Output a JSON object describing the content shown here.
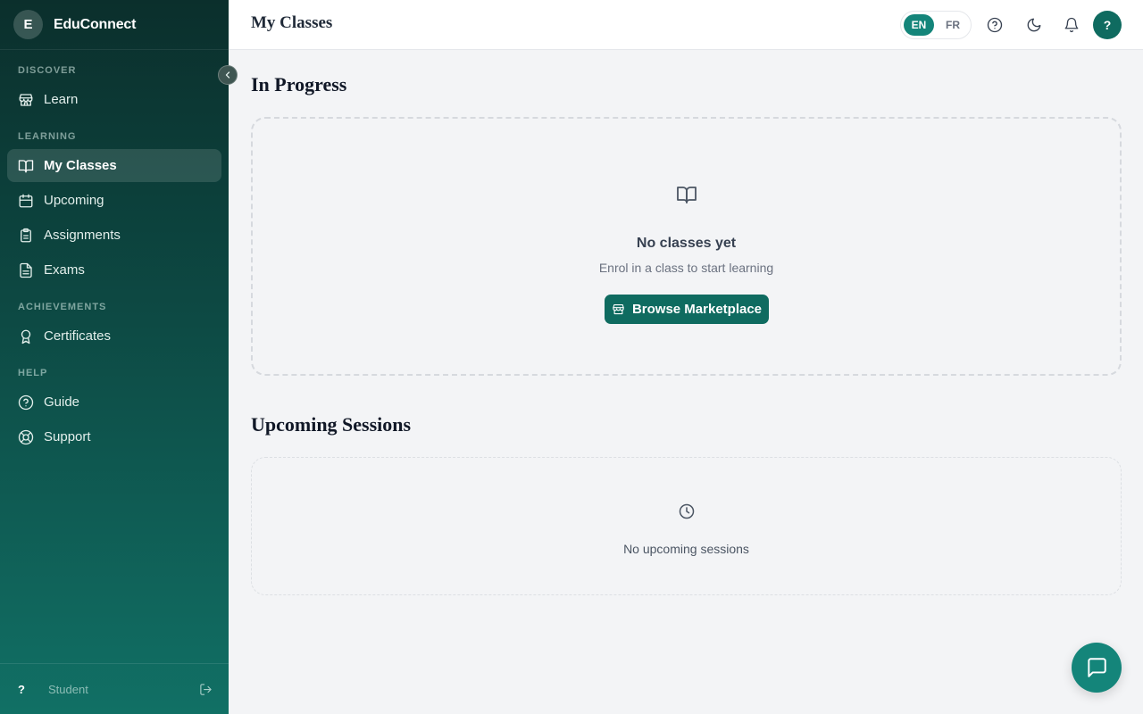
{
  "app": {
    "logo_letter": "E",
    "name": "EduConnect"
  },
  "sidebar": {
    "sections": [
      {
        "label": "DISCOVER"
      },
      {
        "label": "LEARNING"
      },
      {
        "label": "ACHIEVEMENTS"
      },
      {
        "label": "HELP"
      }
    ],
    "items": [
      {
        "label": "Learn",
        "icon": "store-icon"
      },
      {
        "label": "My Classes",
        "icon": "book-open-icon",
        "active": true
      },
      {
        "label": "Upcoming",
        "icon": "calendar-icon"
      },
      {
        "label": "Assignments",
        "icon": "clipboard-icon"
      },
      {
        "label": "Exams",
        "icon": "file-text-icon"
      },
      {
        "label": "Certificates",
        "icon": "award-icon"
      },
      {
        "label": "Guide",
        "icon": "help-circle-icon"
      },
      {
        "label": "Support",
        "icon": "life-buoy-icon"
      }
    ],
    "footer": {
      "avatar_text": "?",
      "role": "Student",
      "icon": "logout-icon"
    }
  },
  "header": {
    "title": "My Classes",
    "languages": [
      "EN",
      "FR"
    ],
    "active_language": "EN",
    "icons": [
      "help-circle-icon",
      "moon-icon",
      "bell-icon"
    ],
    "user_avatar": "?"
  },
  "main": {
    "in_progress": {
      "title": "In Progress",
      "empty_title": "No classes yet",
      "empty_subtitle": "Enrol in a class to start learning",
      "button_label": "Browse Marketplace"
    },
    "upcoming": {
      "title": "Upcoming Sessions",
      "empty_text": "No upcoming sessions"
    }
  },
  "colors": {
    "accent": "#0f6b60",
    "accent_light": "#14857a",
    "sidebar_top": "#0b2f2c",
    "sidebar_bottom": "#117065"
  }
}
